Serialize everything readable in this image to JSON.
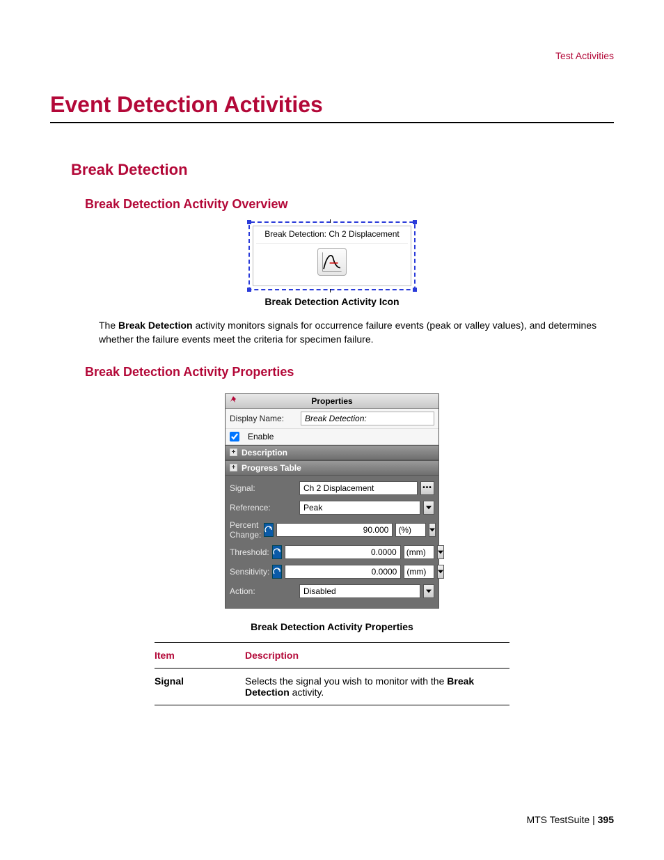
{
  "header": {
    "section_link": "Test Activities"
  },
  "h1": "Event Detection Activities",
  "h2": "Break Detection",
  "overview": {
    "heading": "Break Detection Activity Overview",
    "icon_label": "Break Detection: Ch 2 Displacement",
    "icon_caption": "Break Detection Activity Icon",
    "paragraph_pre": "The ",
    "paragraph_bold": "Break Detection",
    "paragraph_post": " activity monitors signals for occurrence failure events (peak or valley values), and determines whether the failure events meet the criteria for specimen failure."
  },
  "properties": {
    "heading": "Break Detection Activity Properties",
    "panel_title": "Properties",
    "display_name_label": "Display Name:",
    "display_name_value": "Break Detection:",
    "enable_label": "Enable",
    "enable_checked": true,
    "section_description": "Description",
    "section_progress": "Progress Table",
    "fields": {
      "signal": {
        "label": "Signal:",
        "value": "Ch 2 Displacement"
      },
      "reference": {
        "label": "Reference:",
        "value": "Peak"
      },
      "percent_change": {
        "label": "Percent Change:",
        "value": "90.000",
        "unit": "(%)"
      },
      "threshold": {
        "label": "Threshold:",
        "value": "0.0000",
        "unit": "(mm)"
      },
      "sensitivity": {
        "label": "Sensitivity:",
        "value": "0.0000",
        "unit": "(mm)"
      },
      "action": {
        "label": "Action:",
        "value": "Disabled"
      }
    },
    "caption": "Break Detection Activity Properties"
  },
  "table": {
    "col_item": "Item",
    "col_desc": "Description",
    "rows": [
      {
        "item": "Signal",
        "desc_pre": "Selects the signal you wish to monitor with the ",
        "desc_bold": "Break Detection",
        "desc_post": " activity."
      }
    ]
  },
  "footer": {
    "product": "MTS TestSuite",
    "sep": " | ",
    "page": "395"
  }
}
